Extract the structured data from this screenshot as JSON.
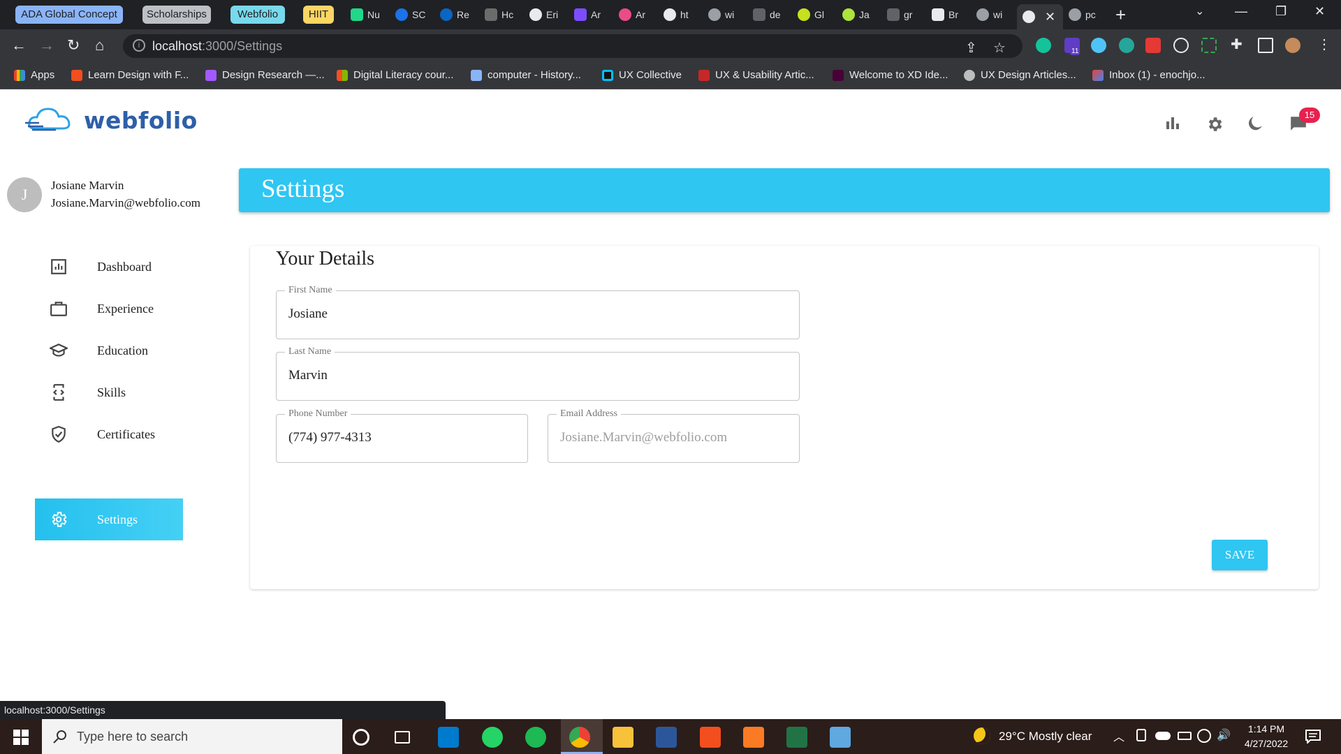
{
  "browser": {
    "tab_groups": [
      {
        "label": "ADA Global Concept",
        "color": "#8ab4f8"
      },
      {
        "label": "Scholarships",
        "color": "#bdc1c6"
      },
      {
        "label": "Webfolio",
        "color": "#78d9ec"
      },
      {
        "label": "HIIT",
        "color": "#fdd663"
      }
    ],
    "tabs": [
      "Nu",
      "SC",
      "Re",
      "Hc",
      "Eri",
      "Ar",
      "Ar",
      "ht",
      "wi",
      "de",
      "Gl",
      "Ja",
      "gr",
      "Br",
      "wi",
      "",
      "pc"
    ],
    "active_tab_index": 15,
    "url_host": "localhost",
    "url_path": ":3000/Settings",
    "extension_badge": "11",
    "bookmarks": [
      "Apps",
      "Learn Design with F...",
      "Design Research —...",
      "Digital Literacy cour...",
      "computer - History...",
      "UX Collective",
      "UX & Usability Artic...",
      "Welcome to XD Ide...",
      "UX Design Articles...",
      "Inbox (1) - enochjo..."
    ],
    "status_url": "localhost:3000/Settings"
  },
  "app": {
    "logo_text": "webfolio",
    "notification_count": "15",
    "user": {
      "initial": "J",
      "name": "Josiane Marvin",
      "email": "Josiane.Marvin@webfolio.com"
    },
    "nav": [
      {
        "label": "Dashboard",
        "icon": "dashboard-icon"
      },
      {
        "label": "Experience",
        "icon": "briefcase-icon"
      },
      {
        "label": "Education",
        "icon": "graduation-cap-icon"
      },
      {
        "label": "Skills",
        "icon": "code-file-icon"
      },
      {
        "label": "Certificates",
        "icon": "shield-check-icon"
      },
      {
        "label": "Settings",
        "icon": "gear-icon"
      }
    ],
    "active_nav": "Settings",
    "page_title": "Settings",
    "section_title": "Your Details",
    "form": {
      "first_name_label": "First Name",
      "first_name_value": "Josiane",
      "last_name_label": "Last Name",
      "last_name_value": "Marvin",
      "phone_label": "Phone Number",
      "phone_value": "(774) 977-4313",
      "email_label": "Email Address",
      "email_value": "Josiane.Marvin@webfolio.com"
    },
    "save_label": "SAVE",
    "accent_color": "#2fc6f2",
    "brand_color": "#2e5fa8"
  },
  "taskbar": {
    "search_placeholder": "Type here to search",
    "weather": "29°C  Mostly clear",
    "time": "1:14 PM",
    "date": "4/27/2022"
  }
}
